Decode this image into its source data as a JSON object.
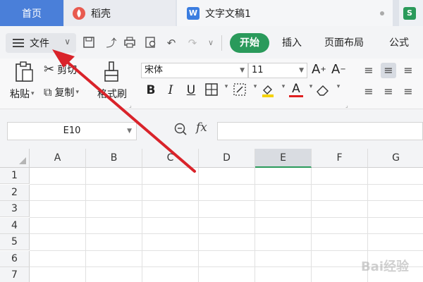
{
  "tabs": {
    "home": "首页",
    "daoke": "稻壳",
    "doc": "文字文稿1",
    "s_icon": "S"
  },
  "quickbar": {
    "file_label": "文件",
    "ribbon_tabs": [
      "开始",
      "插入",
      "页面布局",
      "公式"
    ]
  },
  "ribbon": {
    "paste": "粘贴",
    "cut": "剪切",
    "copy": "复制",
    "format_painter": "格式刷",
    "font_name": "宋体",
    "font_size": "11"
  },
  "formula_bar": {
    "cell_ref": "E10",
    "fx": "fx",
    "value": ""
  },
  "grid": {
    "columns": [
      "A",
      "B",
      "C",
      "D",
      "E",
      "F",
      "G"
    ],
    "active_column": "E",
    "rows": [
      "1",
      "2",
      "3",
      "4",
      "5",
      "6",
      "7"
    ]
  },
  "colors": {
    "accent": "#2a9a5b",
    "home_tab": "#4a7fd9",
    "arrow": "#d9232a"
  },
  "watermark": "Bai经验"
}
